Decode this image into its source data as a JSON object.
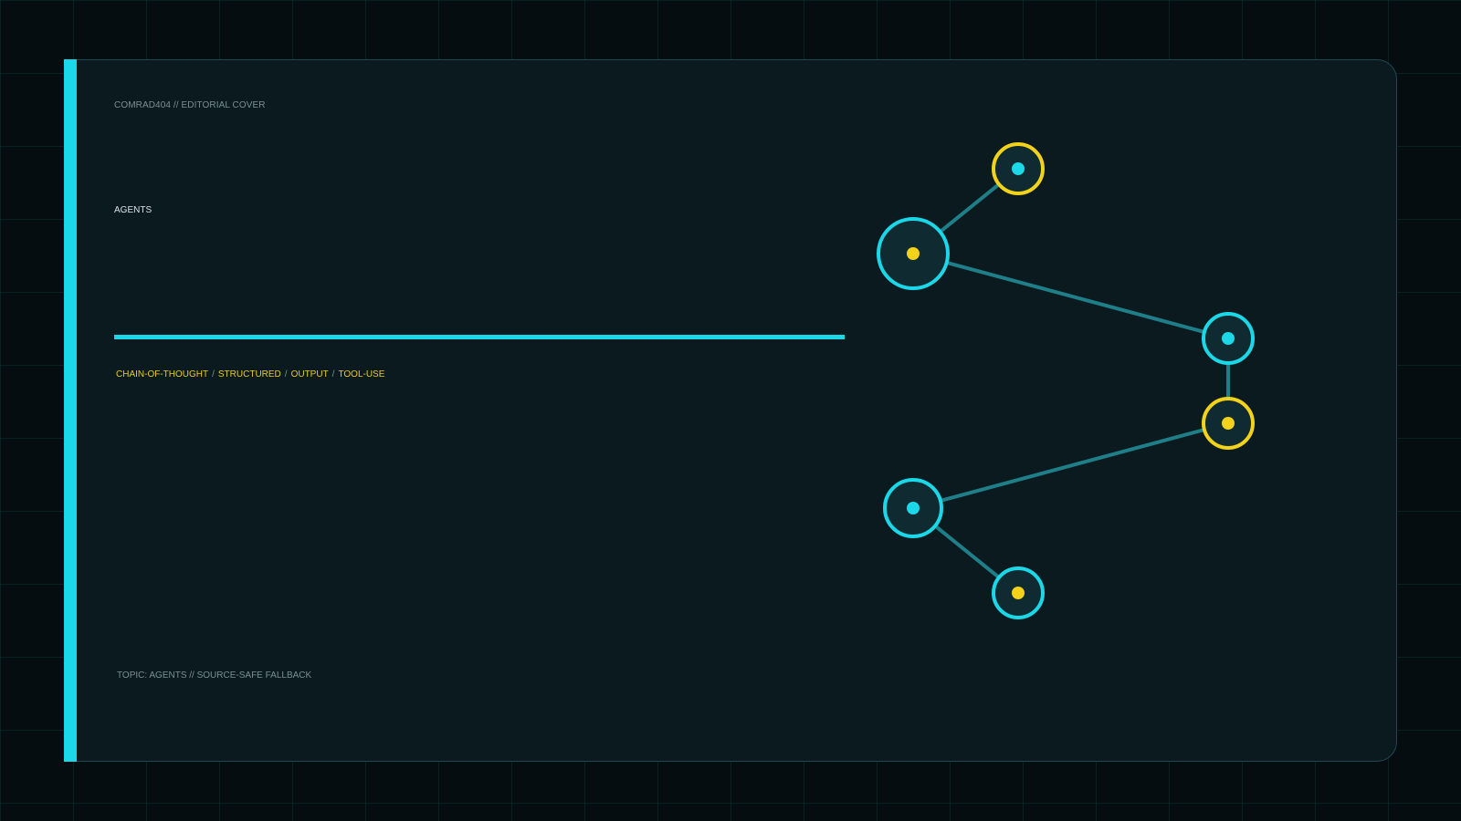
{
  "header": {
    "kicker": "COMRAD404 // EDITORIAL COVER"
  },
  "main": {
    "section_label": "AGENTS",
    "tags": [
      "CHAIN-OF-THOUGHT",
      "STRUCTURED",
      "OUTPUT",
      "TOOL-USE"
    ],
    "tag_separator": "/"
  },
  "footer": {
    "text": "TOPIC: AGENTS // SOURCE-SAFE FALLBACK"
  },
  "colors": {
    "background": "#050d10",
    "card": "#0b1a1f",
    "accent_cyan": "#1ad8e8",
    "accent_yellow": "#f2d21a",
    "edge": "#1f7f88",
    "muted_text": "#7a8f95"
  },
  "graph": {
    "nodes": [
      {
        "id": "n1",
        "ring_color": "yellow",
        "dot_color": "cyan",
        "size": "small"
      },
      {
        "id": "n2",
        "ring_color": "cyan",
        "dot_color": "yellow",
        "size": "large"
      },
      {
        "id": "n3",
        "ring_color": "cyan",
        "dot_color": "cyan",
        "size": "small"
      },
      {
        "id": "n4",
        "ring_color": "yellow",
        "dot_color": "yellow",
        "size": "small"
      },
      {
        "id": "n5",
        "ring_color": "cyan",
        "dot_color": "cyan",
        "size": "medium"
      },
      {
        "id": "n6",
        "ring_color": "cyan",
        "dot_color": "yellow",
        "size": "small"
      }
    ],
    "edges": [
      [
        "n1",
        "n2"
      ],
      [
        "n2",
        "n3"
      ],
      [
        "n3",
        "n4"
      ],
      [
        "n4",
        "n5"
      ],
      [
        "n5",
        "n6"
      ]
    ]
  }
}
